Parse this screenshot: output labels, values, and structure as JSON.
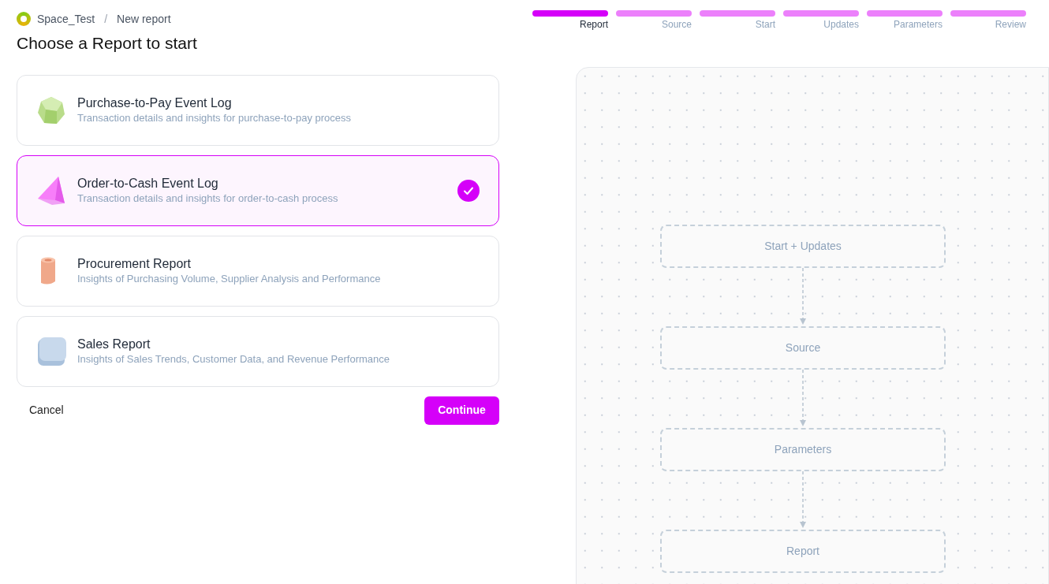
{
  "breadcrumb": {
    "space": "Space_Test",
    "separator": "/",
    "page": "New report"
  },
  "title": "Choose a Report to start",
  "steps": [
    {
      "label": "Report",
      "selected": true
    },
    {
      "label": "Source",
      "selected": false
    },
    {
      "label": "Start",
      "selected": false
    },
    {
      "label": "Updates",
      "selected": false
    },
    {
      "label": "Parameters",
      "selected": false
    },
    {
      "label": "Review",
      "selected": false
    }
  ],
  "reports": [
    {
      "kind": "gem",
      "title": "Purchase-to-Pay Event Log",
      "description": "Transaction details and insights for purchase-to-pay process",
      "selected": false
    },
    {
      "kind": "pyramid",
      "title": "Order-to-Cash Event Log",
      "description": "Transaction details and insights for order-to-cash process",
      "selected": true
    },
    {
      "kind": "cylinder",
      "title": "Procurement Report",
      "description": "Insights of Purchasing Volume, Supplier Analysis and Performance",
      "selected": false
    },
    {
      "kind": "cube",
      "title": "Sales Report",
      "description": "Insights of Sales Trends, Customer Data, and Revenue Performance",
      "selected": false
    }
  ],
  "buttons": {
    "cancel": "Cancel",
    "continue": "Continue"
  },
  "flow": [
    "Start + Updates",
    "Source",
    "Parameters",
    "Report"
  ]
}
